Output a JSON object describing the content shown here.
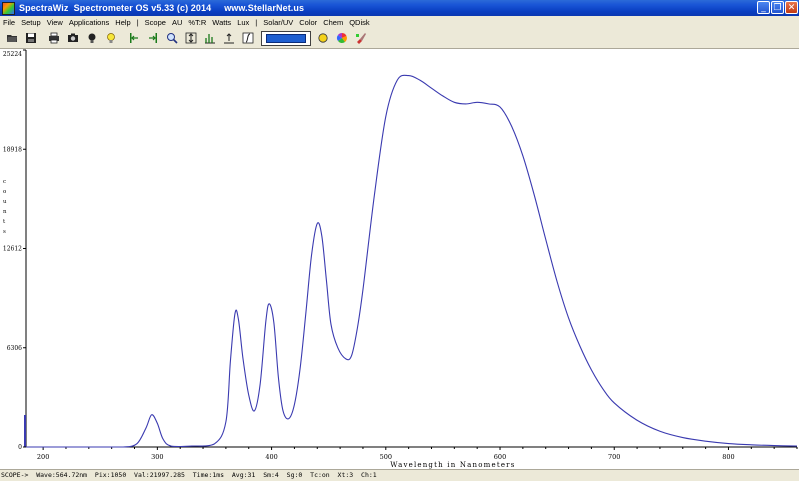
{
  "window": {
    "title": "SpectraWiz  Spectrometer OS v5.33 (c) 2014     www.StellarNet.us",
    "minimize_glyph": "_",
    "restore_glyph": "❐",
    "close_glyph": "✕"
  },
  "menu": {
    "items": [
      "File",
      "Setup",
      "View",
      "Applications",
      "Help",
      "|",
      "Scope",
      "AU",
      "%T:R",
      "Watts",
      "Lux",
      "|",
      "Solar/UV",
      "Color",
      "Chem",
      "QDisk"
    ]
  },
  "toolbar": {
    "icons": [
      "open-icon",
      "save-icon",
      "print-icon",
      "camera-icon",
      "lamp-icon",
      "bulb-icon",
      "cursor-left-icon",
      "cursor-right-icon",
      "zoom-icon",
      "autoscale-icon",
      "peak-icon",
      "baseline-icon",
      "integration-icon"
    ],
    "trace_color": "#1f5fd0",
    "tail_icons": [
      "yellow-circle-icon",
      "color-wheel-icon",
      "paint-icon"
    ]
  },
  "colors": {
    "trace": "#3a3ab0",
    "axis": "#000000",
    "plot_bg": "#ffffff"
  },
  "chart_data": {
    "type": "line",
    "title": "",
    "xlabel": "Wavelength in Nanometers",
    "ylabel": "Counts",
    "ylabel_letters": [
      "C",
      "O",
      "U",
      "N",
      "T",
      "S"
    ],
    "xlim": [
      185,
      860
    ],
    "ylim": [
      0,
      25224
    ],
    "yticks": [
      0,
      6306,
      12612,
      18918,
      25224
    ],
    "ytick_labels": [
      "0",
      "6306",
      "12612",
      "18918",
      "25224"
    ],
    "xticks": [
      200,
      300,
      400,
      500,
      600,
      700,
      800
    ],
    "xtick_labels": [
      "200",
      "300",
      "400",
      "500",
      "600",
      "700",
      "800"
    ],
    "grid": false,
    "series": [
      {
        "name": "",
        "x": [
          185,
          200,
          250,
          270,
          282,
          290,
          295,
          300,
          305,
          312,
          330,
          350,
          360,
          364,
          368,
          371,
          375,
          380,
          385,
          390,
          395,
          398,
          402,
          406,
          410,
          415,
          420,
          425,
          430,
          435,
          440,
          444,
          448,
          452,
          458,
          465,
          470,
          475,
          480,
          490,
          500,
          510,
          520,
          530,
          540,
          550,
          560,
          570,
          580,
          590,
          600,
          610,
          620,
          630,
          640,
          650,
          660,
          670,
          680,
          690,
          700,
          720,
          740,
          760,
          780,
          800,
          820,
          840,
          860
        ],
        "y": [
          0,
          0,
          0,
          0,
          200,
          1200,
          2050,
          1500,
          500,
          60,
          60,
          200,
          1600,
          5500,
          8500,
          8100,
          5600,
          3300,
          2300,
          4000,
          8000,
          9100,
          7900,
          4400,
          2300,
          1800,
          2700,
          5000,
          8500,
          12200,
          14200,
          13400,
          10600,
          7800,
          6300,
          5600,
          5800,
          7500,
          10000,
          16000,
          21000,
          23300,
          23600,
          23300,
          22800,
          22300,
          21900,
          21800,
          21900,
          21800,
          21600,
          20400,
          18500,
          16000,
          13200,
          10500,
          8200,
          6400,
          4900,
          3700,
          2800,
          1700,
          1000,
          600,
          370,
          220,
          140,
          90,
          60
        ]
      }
    ]
  },
  "status": {
    "text": "SCOPE->  Wave:564.72nm  Pix:1050  Val:21997.285  Time:1ms  Avg:31  Sm:4  Sg:0  Tc:on  Xt:3  Ch:1"
  }
}
